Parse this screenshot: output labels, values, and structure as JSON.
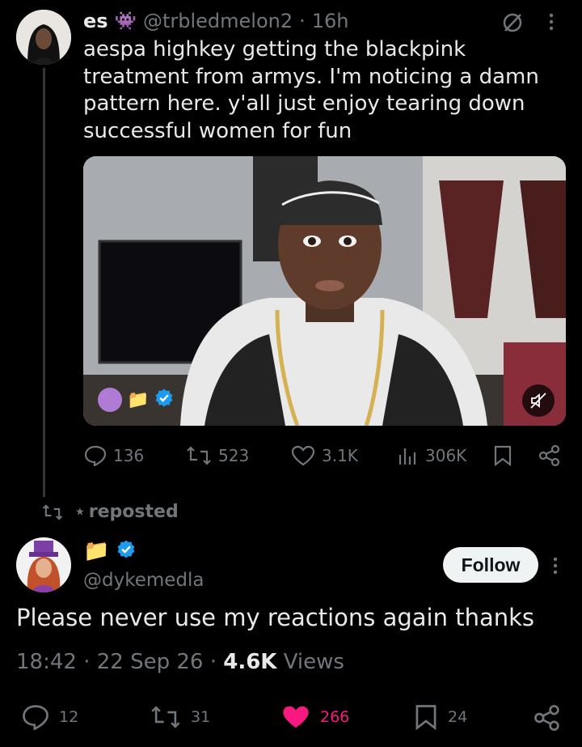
{
  "quoted_post": {
    "display_name": "es",
    "name_emoji": "👾",
    "handle": "@trbledmelon2",
    "separator": "·",
    "time": "16h",
    "text": "aespa highkey getting the blackpink treatment from armys. I'm noticing a damn pattern here. y'all just enjoy tearing down successful women for fun",
    "media_overlay_emoji": "📁",
    "stats": {
      "replies": "136",
      "reposts": "523",
      "likes": "3.1K",
      "views": "306K"
    }
  },
  "repost_label": "reposted",
  "post": {
    "name_emoji": "📁",
    "handle": "@dykemedla",
    "follow_label": "Follow",
    "text": "Please never use my reactions again thanks",
    "time": "18:42",
    "date": "22 Sep 26",
    "views_count": "4.6K",
    "views_label": "Views",
    "stats": {
      "replies": "12",
      "reposts": "31",
      "likes": "266",
      "bookmarks": "24"
    }
  },
  "colors": {
    "background": "#000000",
    "text": "#e7e9ea",
    "muted": "#71767b",
    "like": "#f91880",
    "verified": "#1d9bf0",
    "follow_bg": "#eff3f4"
  }
}
